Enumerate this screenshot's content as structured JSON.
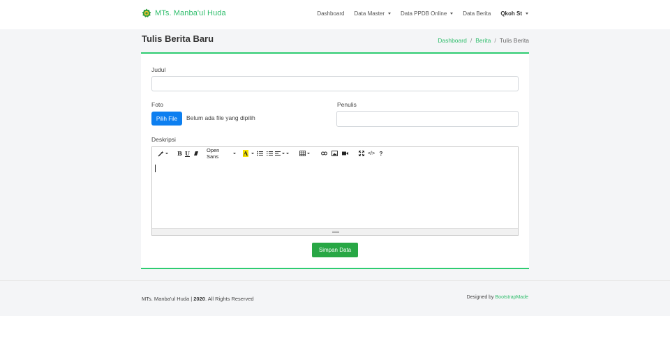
{
  "brand": {
    "name": "MTs. Manba'ul Huda",
    "logo_icon": "school-logo-icon"
  },
  "nav": {
    "items": [
      {
        "label": "Dashboard",
        "dropdown": false
      },
      {
        "label": "Data Master",
        "dropdown": true
      },
      {
        "label": "Data PPDB Online",
        "dropdown": true
      },
      {
        "label": "Data Berita",
        "dropdown": false
      }
    ],
    "user": "Qkoh St"
  },
  "page": {
    "title": "Tulis Berita Baru",
    "breadcrumb": [
      "Dashboard",
      "Berita",
      "Tulis Berita"
    ]
  },
  "form": {
    "judul_label": "Judul",
    "judul_value": "",
    "foto_label": "Foto",
    "file_button": "Pilih File",
    "file_status": "Belum ada file yang dipilih",
    "penulis_label": "Penulis",
    "penulis_value": "",
    "deskripsi_label": "Deskripsi",
    "editor": {
      "font_name": "Open Sans",
      "toolbar_icons": [
        "magic-style-icon",
        "bold-icon",
        "underline-icon",
        "eraser-icon",
        "font-name-dropdown",
        "text-color-icon",
        "unordered-list-icon",
        "ordered-list-icon",
        "paragraph-align-icon",
        "table-icon",
        "link-icon",
        "picture-icon",
        "video-icon",
        "fullscreen-icon",
        "code-view-icon",
        "help-icon"
      ],
      "content": ""
    },
    "submit_label": "Simpan Data"
  },
  "footer": {
    "school": "MTs. Manba'ul Huda",
    "year": "2020",
    "rights": ". All Rights Reserved",
    "designed_by": "Designed by",
    "designer": "BootstrapMade"
  },
  "colors": {
    "accent": "#2ecc71",
    "primary": "#0d7ff0",
    "success": "#28a745"
  }
}
